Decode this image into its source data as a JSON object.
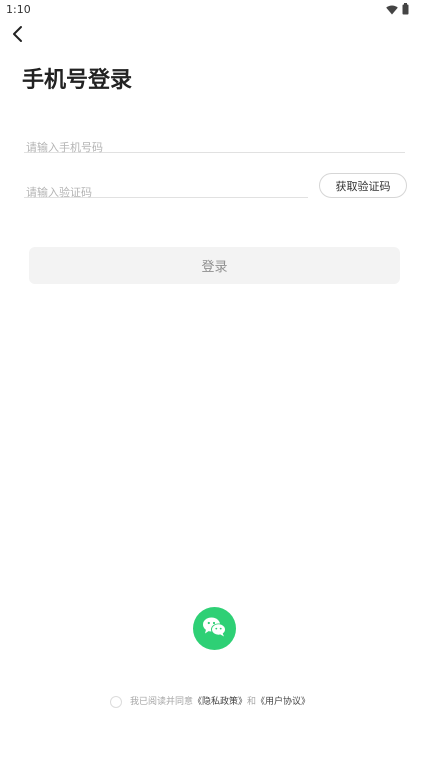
{
  "status_bar": {
    "time": "1:10",
    "icons": [
      "wifi-icon",
      "battery-icon"
    ]
  },
  "header": {
    "back_icon": "chevron-left-icon",
    "title": "手机号登录"
  },
  "form": {
    "phone_placeholder": "请输入手机号码",
    "phone_value": "",
    "code_placeholder": "请输入验证码",
    "code_value": "",
    "get_code_label": "获取验证码",
    "login_label": "登录"
  },
  "social": {
    "wechat_icon": "wechat-icon"
  },
  "agreement": {
    "prefix": "我已阅读并同意",
    "privacy_link": "《隐私政策》",
    "conjunction": "和",
    "terms_link": "《用户协议》"
  },
  "colors": {
    "wechat_green": "#2ed075",
    "login_button_bg": "#f3f3f3",
    "placeholder_gray": "#b4b4b4"
  }
}
